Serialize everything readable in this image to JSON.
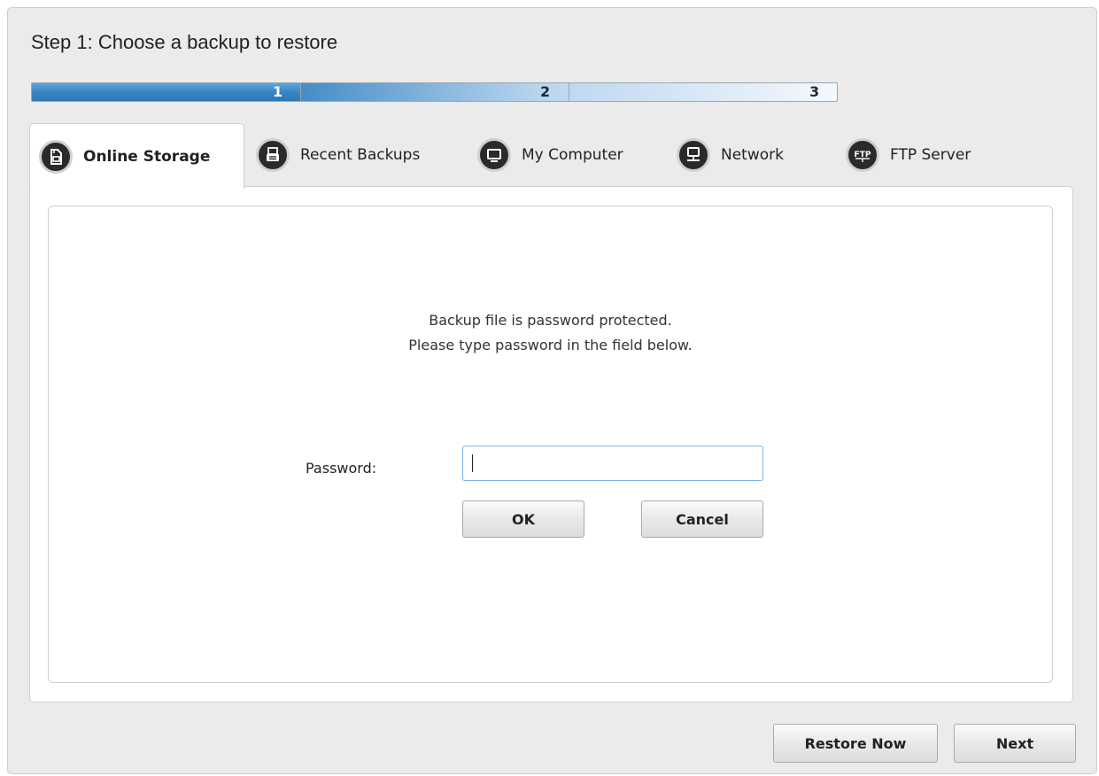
{
  "step": {
    "title": "Step 1: Choose a backup to restore",
    "progress_fraction": 0.333,
    "segments": [
      "1",
      "2",
      "3"
    ]
  },
  "tabs": [
    {
      "label": "Online Storage",
      "icon": "online-storage-icon",
      "active": true
    },
    {
      "label": "Recent Backups",
      "icon": "recent-backups-icon",
      "active": false
    },
    {
      "label": "My Computer",
      "icon": "my-computer-icon",
      "active": false
    },
    {
      "label": "Network",
      "icon": "network-icon",
      "active": false
    },
    {
      "label": "FTP Server",
      "icon": "ftp-server-icon",
      "active": false
    }
  ],
  "dialog": {
    "message_line1": "Backup file is password protected.",
    "message_line2": "Please type password in the field below.",
    "password_label": "Password:",
    "password_value": "",
    "ok_label": "OK",
    "cancel_label": "Cancel"
  },
  "footer": {
    "restore_now_label": "Restore Now",
    "next_label": "Next"
  },
  "colors": {
    "progress_accent": "#3a86c4",
    "focus_border": "#7eb4ea"
  }
}
